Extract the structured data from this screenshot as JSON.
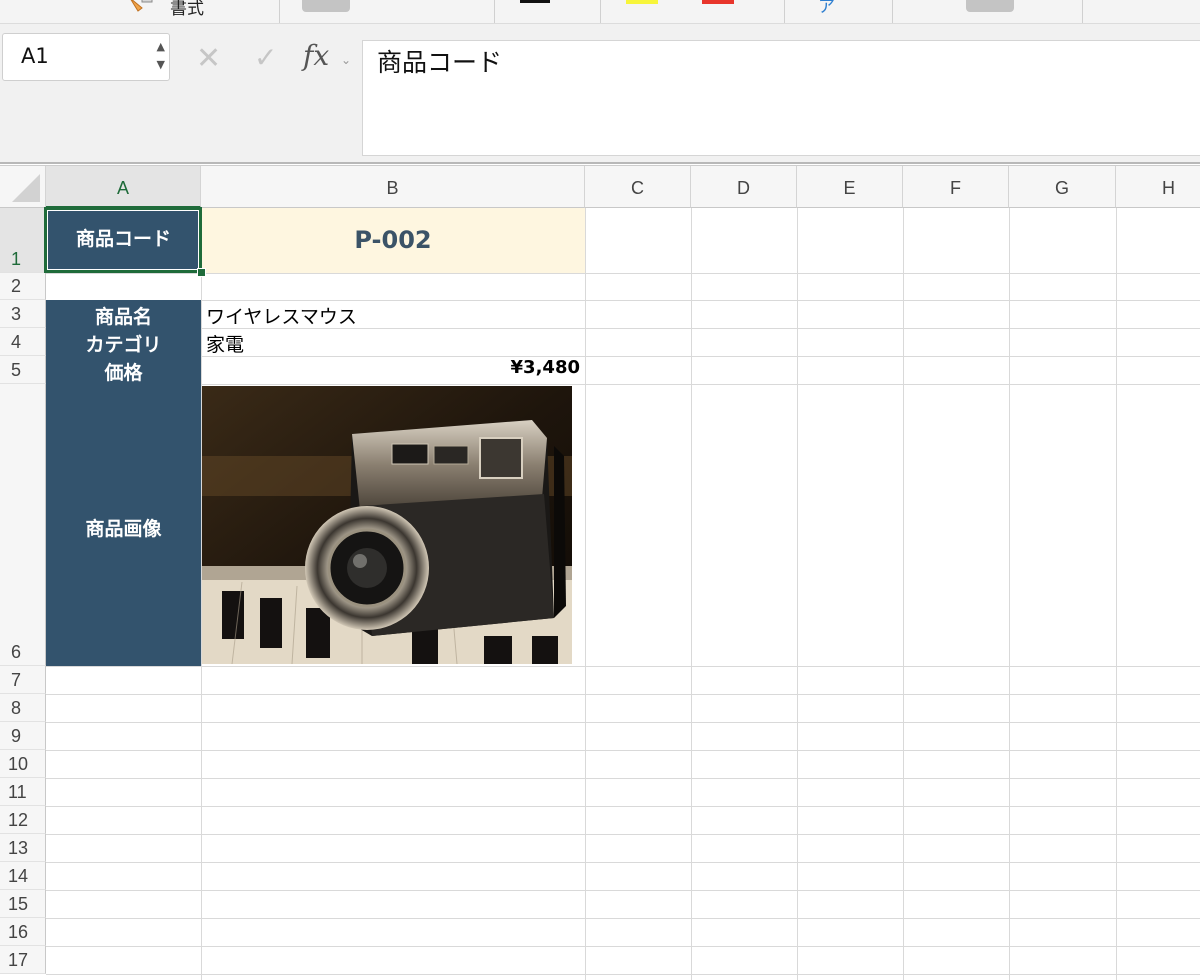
{
  "ribbon": {
    "format_label": "書式"
  },
  "formula_bar": {
    "name_box": "A1",
    "fx_label": "fx",
    "content": "商品コード"
  },
  "grid": {
    "column_headers": [
      "A",
      "B",
      "C",
      "D",
      "E",
      "F",
      "G",
      "H"
    ],
    "row_headers": [
      "1",
      "2",
      "3",
      "4",
      "5",
      "6",
      "7",
      "8",
      "9",
      "10",
      "11",
      "12",
      "13",
      "14",
      "15",
      "16",
      "17"
    ],
    "active_cell": "A1"
  },
  "cells": {
    "a1": "商品コード",
    "b1": "P-002",
    "a3": "商品名",
    "a4": "カテゴリ",
    "a5": "価格",
    "a6": "商品画像",
    "b3": "ワイヤレスマウス",
    "b4": "家電",
    "b5": "¥3,480"
  },
  "image": {
    "subject": "vintage-camera-on-piano-keys"
  },
  "colors": {
    "header_fill": "#33536d",
    "code_fill": "#fef6e0",
    "code_text": "#3b5367",
    "selection": "#1f6b3a"
  }
}
